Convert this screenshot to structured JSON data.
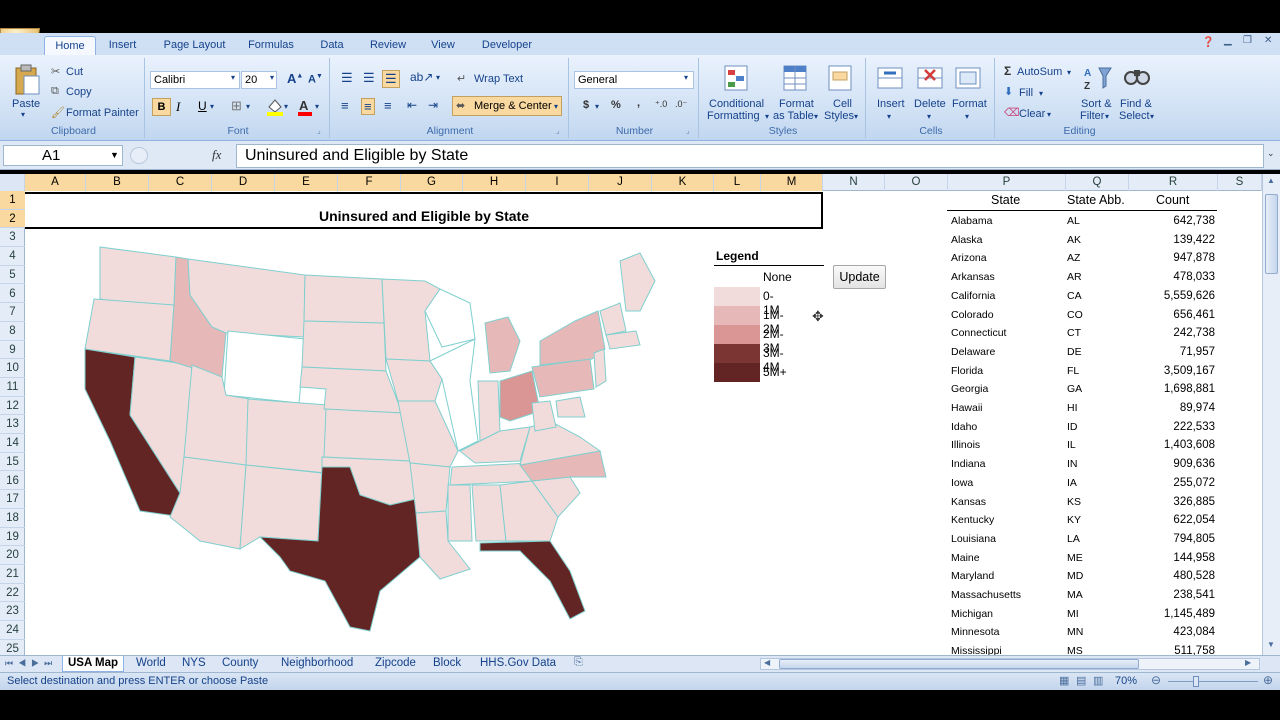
{
  "ribbon_tabs": [
    "Home",
    "Insert",
    "Page Layout",
    "Formulas",
    "Data",
    "Review",
    "View",
    "Developer"
  ],
  "clipboard": {
    "paste": "Paste",
    "cut": "Cut",
    "copy": "Copy",
    "format_painter": "Format Painter",
    "label": "Clipboard"
  },
  "font": {
    "name": "Calibri",
    "size": "20",
    "bold": "B",
    "italic": "I",
    "underline": "U",
    "label": "Font"
  },
  "alignment": {
    "wrap_text": "Wrap Text",
    "merge_center": "Merge & Center",
    "label": "Alignment"
  },
  "number": {
    "format": "General",
    "currency": "$",
    "percent": "%",
    "comma": ",",
    "label": "Number"
  },
  "styles": {
    "conditional": "Conditional",
    "formatting": "Formatting",
    "format_as": "Format",
    "as_table": "as Table",
    "cell": "Cell",
    "cell_styles": "Styles",
    "label": "Styles"
  },
  "cells": {
    "insert": "Insert",
    "delete": "Delete",
    "format": "Format",
    "label": "Cells"
  },
  "editing": {
    "autosum": "AutoSum",
    "fill": "Fill",
    "clear": "Clear",
    "sort_filter_1": "Sort &",
    "sort_filter_2": "Filter",
    "find_select_1": "Find &",
    "find_select_2": "Select",
    "label": "Editing"
  },
  "formula_bar": {
    "name_box": "A1",
    "fx": "fx",
    "value": "Uninsured and Eligible by State"
  },
  "columns": [
    "A",
    "B",
    "C",
    "D",
    "E",
    "F",
    "G",
    "H",
    "I",
    "J",
    "K",
    "L",
    "M",
    "N",
    "O",
    "P",
    "Q",
    "R",
    "S"
  ],
  "rows": [
    "1",
    "2",
    "3",
    "4",
    "5",
    "6",
    "7",
    "8",
    "9",
    "10",
    "11",
    "12",
    "13",
    "14",
    "15",
    "16",
    "17",
    "18",
    "19",
    "20",
    "21",
    "22",
    "23",
    "24",
    "25"
  ],
  "sheet_title": "Uninsured and Eligible by State",
  "legend": {
    "title": "Legend",
    "items": [
      {
        "label": "None",
        "color": "#ffffff"
      },
      {
        "label": "0-1M",
        "color": "#f2dcdb"
      },
      {
        "label": "1M-2M",
        "color": "#e6b9b8"
      },
      {
        "label": "2M-3M",
        "color": "#d99694"
      },
      {
        "label": "3M-4M",
        "color": "#7b3533"
      },
      {
        "label": "5M+",
        "color": "#632523"
      }
    ]
  },
  "update_button": "Update",
  "table": {
    "headers": [
      "State",
      "State Abb.",
      "Count"
    ],
    "rows": [
      [
        "Alabama",
        "AL",
        "642,738"
      ],
      [
        "Alaska",
        "AK",
        "139,422"
      ],
      [
        "Arizona",
        "AZ",
        "947,878"
      ],
      [
        "Arkansas",
        "AR",
        "478,033"
      ],
      [
        "California",
        "CA",
        "5,559,626"
      ],
      [
        "Colorado",
        "CO",
        "656,461"
      ],
      [
        "Connecticut",
        "CT",
        "242,738"
      ],
      [
        "Delaware",
        "DE",
        "71,957"
      ],
      [
        "Florida",
        "FL",
        "3,509,167"
      ],
      [
        "Georgia",
        "GA",
        "1,698,881"
      ],
      [
        "Hawaii",
        "HI",
        "89,974"
      ],
      [
        "Idaho",
        "ID",
        "222,533"
      ],
      [
        "Illinois",
        "IL",
        "1,403,608"
      ],
      [
        "Indiana",
        "IN",
        "909,636"
      ],
      [
        "Iowa",
        "IA",
        "255,072"
      ],
      [
        "Kansas",
        "KS",
        "326,885"
      ],
      [
        "Kentucky",
        "KY",
        "622,054"
      ],
      [
        "Louisiana",
        "LA",
        "794,805"
      ],
      [
        "Maine",
        "ME",
        "144,958"
      ],
      [
        "Maryland",
        "MD",
        "480,528"
      ],
      [
        "Massachusetts",
        "MA",
        "238,541"
      ],
      [
        "Michigan",
        "MI",
        "1,145,489"
      ],
      [
        "Minnesota",
        "MN",
        "423,084"
      ],
      [
        "Mississippi",
        "MS",
        "511,758"
      ]
    ]
  },
  "sheet_tabs": [
    "USA Map",
    "World",
    "NYS",
    "County",
    "Neighborhood",
    "Zipcode",
    "Block",
    "HHS.Gov Data"
  ],
  "status": {
    "message": "Select destination and press ENTER or choose Paste",
    "zoom": "70%"
  }
}
